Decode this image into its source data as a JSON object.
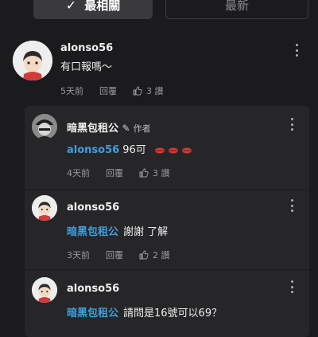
{
  "tabs": {
    "top": "最相關",
    "newest": "最新"
  },
  "comments": [
    {
      "username": "alonso56",
      "text": "有口報嗎～",
      "time": "5天前",
      "reply_label": "回覆",
      "likes": "3 讚"
    }
  ],
  "replies": [
    {
      "username": "暗黑包租公",
      "author_tag": "作者",
      "mention": "alonso56",
      "text": "96可",
      "emoji": "👄👄👄",
      "time": "4天前",
      "reply_label": "回覆",
      "likes": "3 讚"
    },
    {
      "username": "alonso56",
      "mention": "暗黑包租公",
      "text": "謝謝 了解",
      "time": "3天前",
      "reply_label": "回覆",
      "likes": "2 讚"
    },
    {
      "username": "alonso56",
      "mention": "暗黑包租公",
      "text": "請問是16號可以69？"
    }
  ]
}
